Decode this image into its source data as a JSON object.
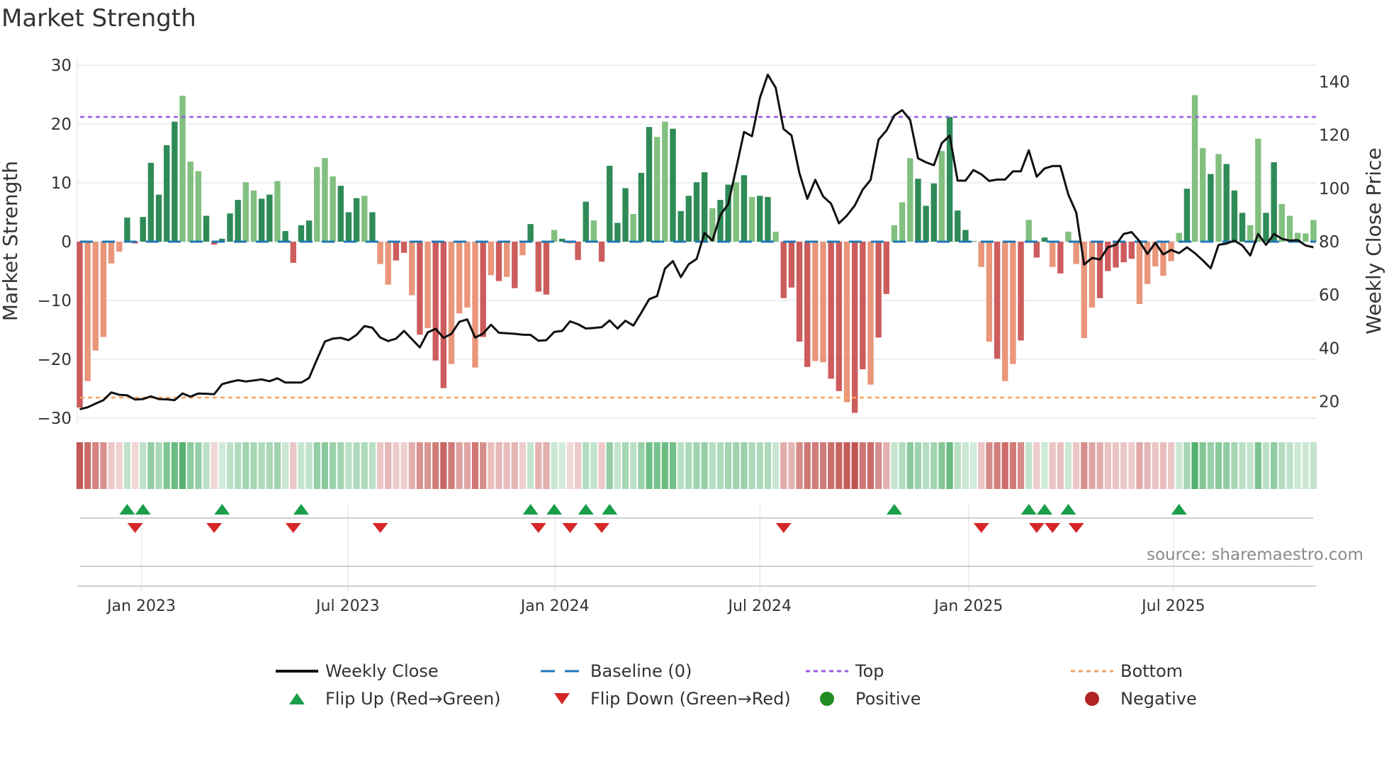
{
  "chart_data": {
    "type": "bar",
    "title": "Market Strength",
    "ylabel": "Market Strength",
    "y2label": "Weekly Close Price",
    "ylim": [
      -31,
      31
    ],
    "y2lim": [
      13,
      147
    ],
    "yticks": [
      "30",
      "20",
      "10",
      "0",
      "−10",
      "−20",
      "−30"
    ],
    "ytick_values": [
      30,
      20,
      10,
      0,
      -10,
      -20,
      -30
    ],
    "y2ticks": [
      "140",
      "120",
      "100",
      "80",
      "60",
      "40",
      "20"
    ],
    "y2tick_values": [
      140,
      120,
      100,
      80,
      60,
      40,
      20
    ],
    "xticks": [
      "Jan 2023",
      "Jul 2023",
      "Jan 2024",
      "Jul 2024",
      "Jan 2025",
      "Jul 2025"
    ],
    "xtick_weeks": [
      8.8,
      34.9,
      61.1,
      87.0,
      113.4,
      139.3
    ],
    "top_level": 21.2,
    "bottom_level": -26.5,
    "baseline": 0,
    "grid": true,
    "strength": [
      -28.2,
      -23.7,
      -18.5,
      -16.2,
      -3.7,
      -1.7,
      4.1,
      -0.3,
      4.2,
      13.4,
      8.0,
      16.4,
      20.4,
      24.8,
      13.6,
      12.0,
      4.4,
      -0.5,
      0.5,
      4.8,
      7.1,
      10.1,
      8.7,
      7.3,
      8.0,
      10.3,
      1.8,
      -3.6,
      2.8,
      3.6,
      12.7,
      14.2,
      11.1,
      9.5,
      5.0,
      7.4,
      7.8,
      5.0,
      -3.8,
      -7.3,
      -3.2,
      -1.9,
      -9.1,
      -15.8,
      -14.7,
      -20.2,
      -24.9,
      -20.8,
      -12.2,
      -11.2,
      -21.4,
      -16.2,
      -5.7,
      -6.7,
      -6.0,
      -7.9,
      -2.3,
      3.0,
      -8.5,
      -9.0,
      2.0,
      0.5,
      -0.3,
      -3.1,
      6.8,
      3.6,
      -3.4,
      12.9,
      3.2,
      9.1,
      4.7,
      11.7,
      19.5,
      17.8,
      20.4,
      19.2,
      5.2,
      7.8,
      10.1,
      11.8,
      5.7,
      7.1,
      9.7,
      10.1,
      11.3,
      7.6,
      7.8,
      7.6,
      1.7,
      -9.6,
      -7.8,
      -17.0,
      -21.3,
      -20.3,
      -20.5,
      -23.3,
      -25.4,
      -27.3,
      -29.1,
      -21.7,
      -24.3,
      -16.3,
      -8.9,
      2.8,
      6.7,
      14.2,
      10.7,
      6.1,
      9.9,
      15.4,
      21.2,
      5.3,
      2.0,
      0.1,
      -4.3,
      -17.0,
      -19.9,
      -23.7,
      -20.8,
      -16.8,
      3.7,
      -2.7,
      0.7,
      -4.3,
      -5.4,
      1.7,
      -3.8,
      -16.4,
      -11.2,
      -9.6,
      -5.0,
      -4.4,
      -3.5,
      -2.9,
      -10.6,
      -7.2,
      -4.2,
      -5.8,
      -3.3,
      1.5,
      9.0,
      24.9,
      15.9,
      11.5,
      14.9,
      13.2,
      8.7,
      4.9,
      2.8,
      17.5,
      4.9,
      13.5,
      6.4,
      4.4,
      1.5,
      1.4,
      3.7
    ],
    "shade": "dllllldddddddllldddddllddlddddllldddldllddldlddlllldldldldddldlddlddddlddlldddddlddldlddlddddllddlddlddllldddlddddlldlldlddldlllldddddlllllldlldldddllddllllldldllllld",
    "weekly_close": [
      17.1,
      17.8,
      19.2,
      20.5,
      23.4,
      22.5,
      22.3,
      20.7,
      20.9,
      21.9,
      20.9,
      20.8,
      20.5,
      23.0,
      21.8,
      23.0,
      22.9,
      22.7,
      26.5,
      27.3,
      28.0,
      27.5,
      27.9,
      28.3,
      27.6,
      28.7,
      27.1,
      27.1,
      27.1,
      28.8,
      35.8,
      42.5,
      43.6,
      43.9,
      43.0,
      45.0,
      48.3,
      47.7,
      44.0,
      42.7,
      43.6,
      46.5,
      43.4,
      40.3,
      45.9,
      47.3,
      43.9,
      45.4,
      49.9,
      50.8,
      44.0,
      45.5,
      48.8,
      45.8,
      45.6,
      45.4,
      45.1,
      45.0,
      42.8,
      43.0,
      46.1,
      46.5,
      50.1,
      49.0,
      47.4,
      47.6,
      47.9,
      50.4,
      47.4,
      50.3,
      48.5,
      53.3,
      58.4,
      59.6,
      69.9,
      72.7,
      66.7,
      71.5,
      73.5,
      83.3,
      80.4,
      90.0,
      94.1,
      107.5,
      121.2,
      119.6,
      134.0,
      142.7,
      137.8,
      122.3,
      119.9,
      105.7,
      96.1,
      103.2,
      97.0,
      94.3,
      86.9,
      89.8,
      93.6,
      99.5,
      103.2,
      118.3,
      121.7,
      127.4,
      129.4,
      125.7,
      111.3,
      109.8,
      108.7,
      117.0,
      119.8,
      102.9,
      102.9,
      106.9,
      105.3,
      102.8,
      103.3,
      103.3,
      106.4,
      106.4,
      114.3,
      104.4,
      107.5,
      108.4,
      108.4,
      97.7,
      90.9,
      71.4,
      73.9,
      73.3,
      77.9,
      78.8,
      82.9,
      83.6,
      80.2,
      75.4,
      79.6,
      75.2,
      76.9,
      75.7,
      77.9,
      75.7,
      73.0,
      70.0,
      78.8,
      79.3,
      80.4,
      78.6,
      74.8,
      82.9,
      78.8,
      82.9,
      81.1,
      80.4,
      80.6,
      78.6,
      77.9
    ],
    "flip_up_weeks": [
      7,
      9,
      19,
      29,
      58,
      61,
      65,
      68,
      104,
      121,
      123,
      126,
      140
    ],
    "flip_down_weeks": [
      8,
      18,
      28,
      39,
      59,
      63,
      67,
      90,
      115,
      122,
      124,
      127
    ],
    "legend": {
      "weekly_close": "Weekly Close",
      "baseline": "Baseline (0)",
      "top": "Top",
      "bottom": "Bottom",
      "flip_up": "Flip Up (Red→Green)",
      "flip_down": "Flip Down (Green→Red)",
      "positive": "Positive",
      "negative": "Negative"
    },
    "legend_placement": "bottom",
    "source": "source: sharemaestro.com",
    "colors": {
      "pos_dark": "#2e8b57",
      "pos_light": "#82c07f",
      "neg_dark": "#cd5c5c",
      "neg_light": "#e9967a",
      "price": "#111111",
      "baseline": "#1f77b4",
      "top": "#9b5de5",
      "bottom": "#f4a261",
      "flip_up": "#1a9e4a",
      "flip_down": "#d62728",
      "positive": "#228b22",
      "negative": "#b22222",
      "strip_pos": "#3aa55a",
      "strip_neg": "#c0504d"
    }
  }
}
